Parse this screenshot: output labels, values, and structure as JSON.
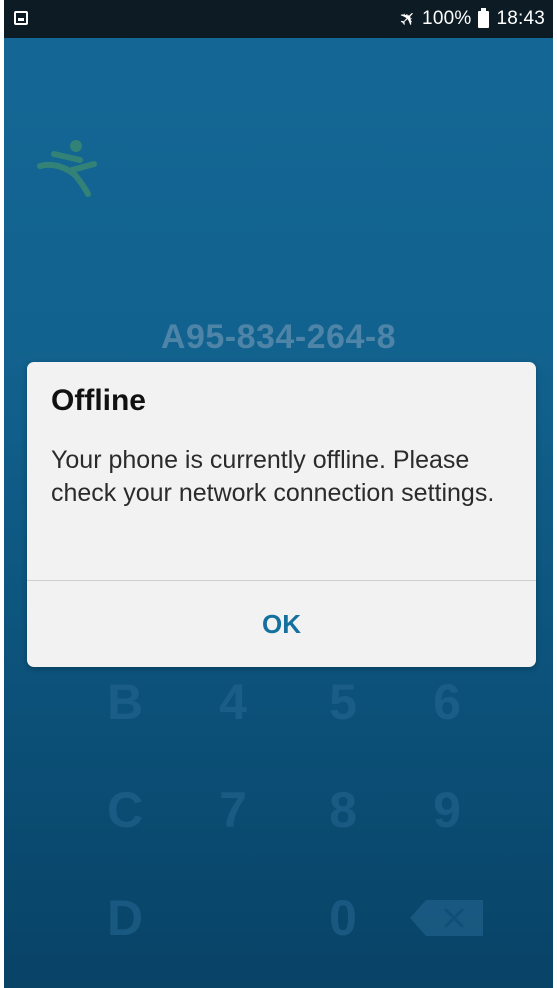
{
  "status_bar": {
    "left_icon": "image-notification-icon",
    "airplane_icon": "airplane-mode-icon",
    "battery_percent": "100%",
    "battery_icon": "battery-icon",
    "time": "18:43"
  },
  "app": {
    "logo_icon": "person-logo-icon",
    "code": "A95-834-264-8",
    "keypad": {
      "row1": [
        "B",
        "4",
        "5",
        "6"
      ],
      "row2": [
        "C",
        "7",
        "8",
        "9"
      ],
      "row3": [
        "D",
        "0"
      ],
      "backspace_icon": "backspace-icon"
    }
  },
  "dialog": {
    "title": "Offline",
    "message": "Your phone is currently offline. Please check your network connection settings.",
    "ok_label": "OK"
  },
  "colors": {
    "background_top": "#1a7aae",
    "background_bottom": "#0b4d75",
    "accent": "#15709f",
    "status_bar": "#0d1b24",
    "dialog_background": "#f2f2f2"
  }
}
